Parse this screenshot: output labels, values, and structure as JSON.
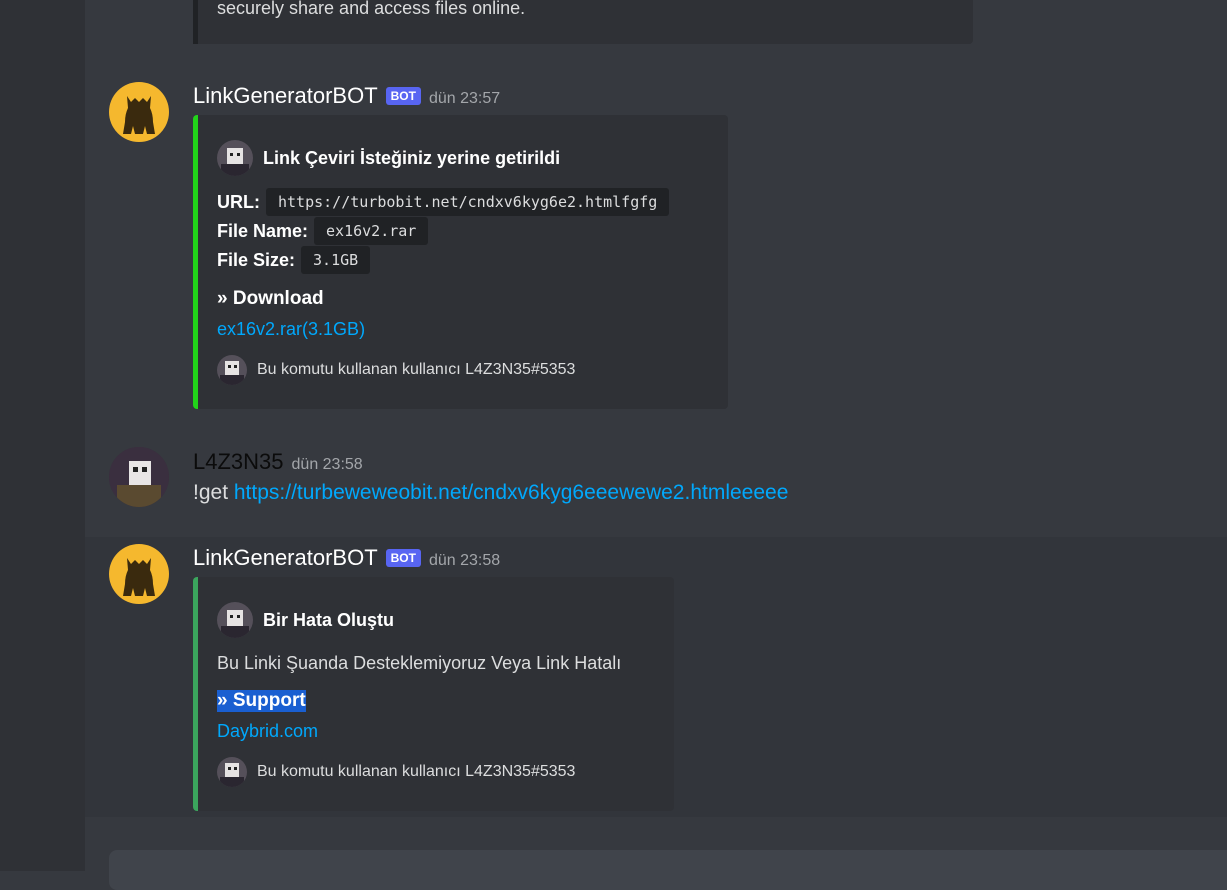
{
  "previous_embed": {
    "text": "securely share and access files online."
  },
  "messages": [
    {
      "author": "LinkGeneratorBOT",
      "bot_tag": "BOT",
      "timestamp": "dün 23:57",
      "embed": {
        "bar_color": "#3ba55d",
        "title": "Link Çeviri İsteğiniz yerine getirildi",
        "fields": [
          {
            "name": "URL:",
            "value": "https://turbobit.net/cndxv6kyg6e2.htmlfgfg"
          },
          {
            "name": "File Name:",
            "value": "ex16v2.rar"
          },
          {
            "name": "File Size:",
            "value": "3.1GB"
          }
        ],
        "section": "» Download",
        "link": "ex16v2.rar(3.1GB)",
        "footer": "Bu komutu kullanan kullanıcı L4Z3N35#5353"
      }
    },
    {
      "author": "L4Z3N35",
      "timestamp": "dün 23:58",
      "text_prefix": "!get ",
      "text_link": "https://turbeweweobit.net/cndxv6kyg6eeewewe2.htmleeeee"
    },
    {
      "author": "LinkGeneratorBOT",
      "bot_tag": "BOT",
      "timestamp": "dün 23:58",
      "embed": {
        "bar_color": "#3ba55d",
        "title": "Bir Hata Oluştu",
        "description": "Bu Linki Şuanda Desteklemiyoruz Veya Link Hatalı",
        "section": "» Support",
        "link": "Daybrid.com",
        "footer": "Bu komutu kullanan kullanıcı L4Z3N35#5353"
      }
    }
  ],
  "colors": {
    "background": "#36393f",
    "embed_background": "#2f3136",
    "link": "#00a8fc",
    "bot_tag": "#5865f2",
    "success_bar": "#22d41a",
    "error_bar": "#3ba55d"
  }
}
